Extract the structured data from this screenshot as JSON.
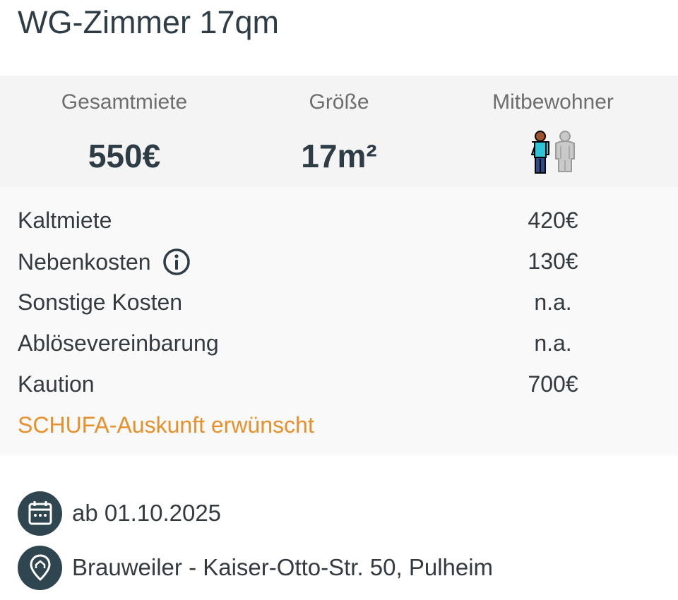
{
  "listing": {
    "title": "WG-Zimmer 17qm"
  },
  "summary": {
    "rent_label": "Gesamtmiete",
    "rent_value": "550€",
    "size_label": "Größe",
    "size_value": "17m²",
    "flatmates_label": "Mitbewohner",
    "flatmates_icons": [
      "person-male-icon",
      "person-placeholder-icon"
    ]
  },
  "costs": {
    "rows": [
      {
        "label": "Kaltmiete",
        "value": "420€"
      },
      {
        "label": "Nebenkosten",
        "value": "130€"
      },
      {
        "label": "Sonstige Kosten",
        "value": "n.a."
      },
      {
        "label": "Ablösevereinbarung",
        "value": "n.a."
      },
      {
        "label": "Kaution",
        "value": "700€"
      }
    ],
    "schufa_note": "SCHUFA-Auskunft erwünscht"
  },
  "details": {
    "available_from": "ab 01.10.2025",
    "address": "Brauweiler - Kaiser-Otto-Str. 50, Pulheim"
  },
  "colors": {
    "primary_dark": "#2e3c45",
    "accent_orange": "#e8902c",
    "icon_background": "#2f4550",
    "summary_background": "#f4f4f4",
    "costs_background": "#f9f9f9"
  }
}
